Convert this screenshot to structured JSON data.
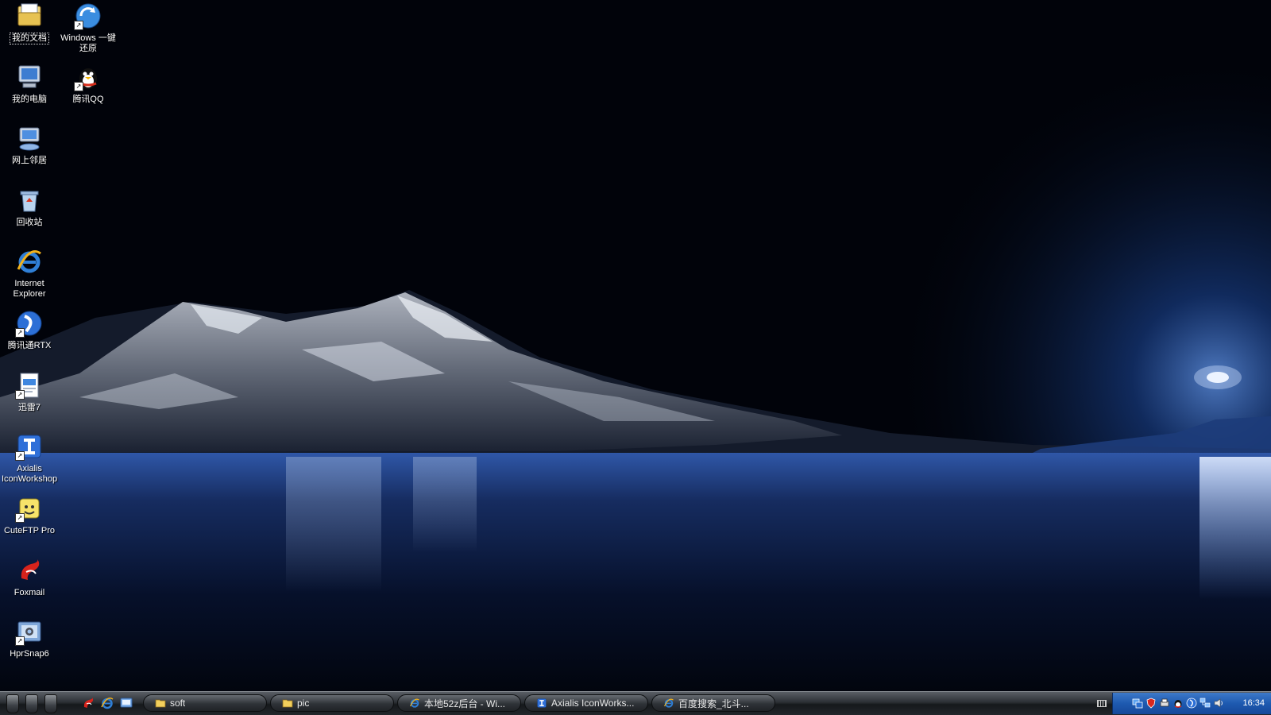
{
  "desktop": {
    "icons": [
      {
        "label": "我的文档",
        "icon": "my-documents-icon",
        "shortcut": false
      },
      {
        "label": "Windows 一键还原",
        "icon": "windows-restore-icon",
        "shortcut": true
      },
      {
        "label": "我的电脑",
        "icon": "my-computer-icon",
        "shortcut": false
      },
      {
        "label": "腾讯QQ",
        "icon": "qq-penguin-icon",
        "shortcut": true
      },
      {
        "label": "网上邻居",
        "icon": "network-places-icon",
        "shortcut": false
      },
      {
        "label": "回收站",
        "icon": "recycle-bin-icon",
        "shortcut": false
      },
      {
        "label": "Internet Explorer",
        "icon": "internet-explorer-icon",
        "shortcut": false
      },
      {
        "label": "腾讯通RTX",
        "icon": "rtx-icon",
        "shortcut": true
      },
      {
        "label": "迅雷7",
        "icon": "thunder-icon",
        "shortcut": true
      },
      {
        "label": "Axialis IconWorkshop",
        "icon": "axialis-icon",
        "shortcut": true
      },
      {
        "label": "CuteFTP Pro",
        "icon": "cuteftp-icon",
        "shortcut": true
      },
      {
        "label": "Foxmail",
        "icon": "foxmail-icon",
        "shortcut": false
      },
      {
        "label": "HprSnap6",
        "icon": "hypersnap-icon",
        "shortcut": true
      }
    ]
  },
  "taskbar": {
    "quicklaunch": [
      "foxmail-icon",
      "internet-explorer-icon",
      "show-desktop-icon"
    ],
    "tasks": [
      {
        "label": "soft",
        "icon": "folder-icon"
      },
      {
        "label": "pic",
        "icon": "folder-icon"
      },
      {
        "label": "本地52z后台 - Wi...",
        "icon": "internet-explorer-icon"
      },
      {
        "label": "Axialis IconWorks...",
        "icon": "axialis-icon"
      },
      {
        "label": "百度搜索_北斗...",
        "icon": "internet-explorer-icon"
      }
    ],
    "tray_icons": [
      "network-icon",
      "antivirus-shield-icon",
      "printer-icon",
      "qq-tray-icon",
      "rtx-tray-icon",
      "network-connection-icon",
      "volume-icon"
    ],
    "clock": "16:34"
  },
  "colors": {
    "tray_blue": "#1e5ab0",
    "taskbar_dark": "#23272b"
  }
}
